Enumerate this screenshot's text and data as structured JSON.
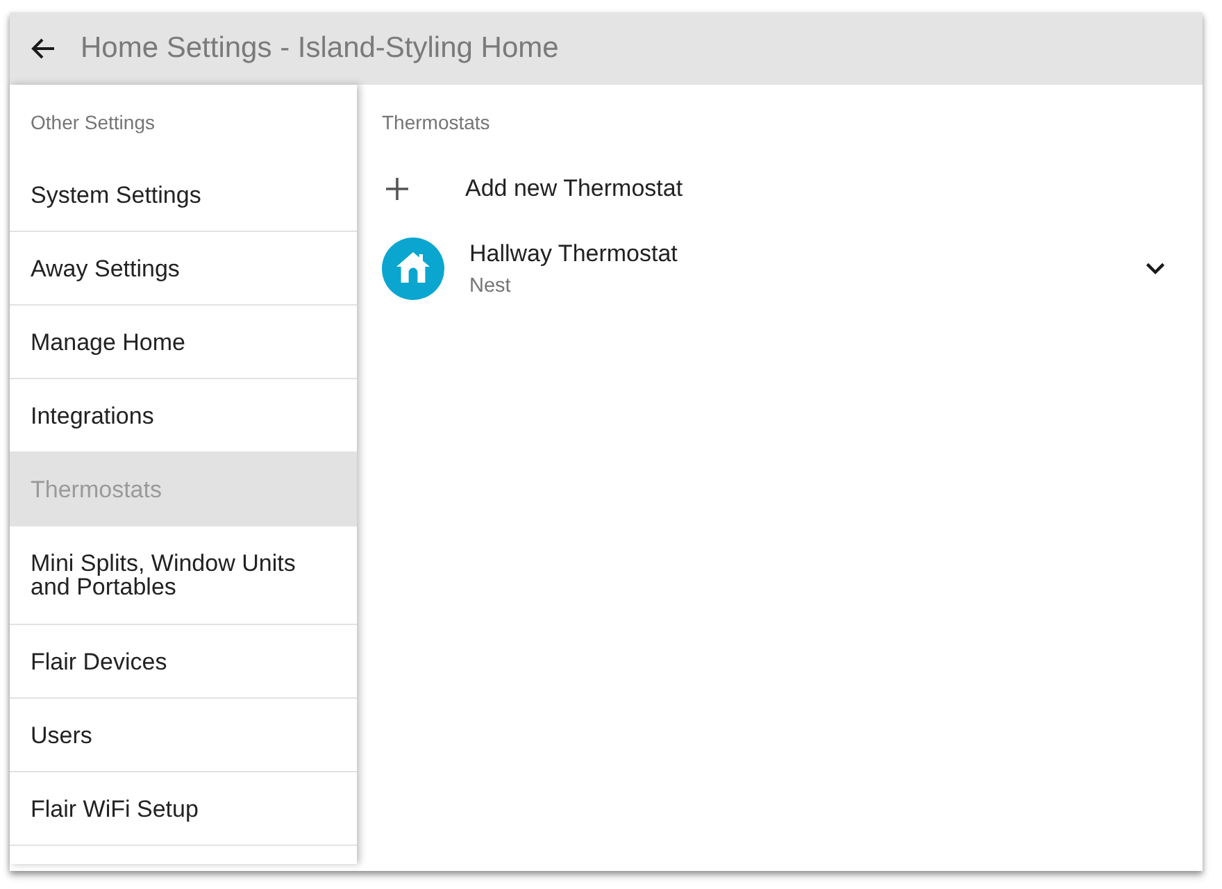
{
  "header": {
    "title": "Home Settings - Island-Styling Home"
  },
  "sidebar": {
    "heading": "Other Settings",
    "items": [
      {
        "label": "System Settings",
        "selected": false
      },
      {
        "label": "Away Settings",
        "selected": false
      },
      {
        "label": "Manage Home",
        "selected": false
      },
      {
        "label": "Integrations",
        "selected": false
      },
      {
        "label": "Thermostats",
        "selected": true
      },
      {
        "label": "Mini Splits, Window Units and Portables",
        "selected": false
      },
      {
        "label": "Flair Devices",
        "selected": false
      },
      {
        "label": "Users",
        "selected": false
      },
      {
        "label": "Flair WiFi Setup",
        "selected": false
      }
    ]
  },
  "content": {
    "heading": "Thermostats",
    "add_action": {
      "label": "Add new Thermostat"
    },
    "thermostats": [
      {
        "name": "Hallway Thermostat",
        "brand": "Nest",
        "expanded": false
      }
    ]
  }
}
